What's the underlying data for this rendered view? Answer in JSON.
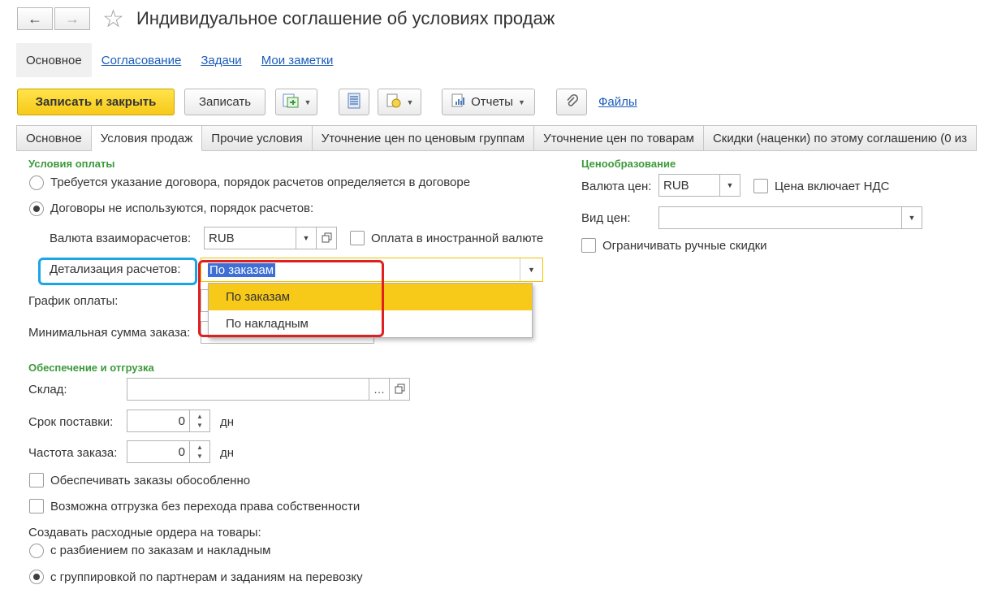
{
  "window": {
    "title": "Индивидуальное соглашение об условиях продаж",
    "back_icon": "←",
    "forward_icon": "→",
    "favorite_icon": "☆"
  },
  "nav_panel": [
    {
      "label": "Основное",
      "active": true
    },
    {
      "label": "Согласование",
      "active": false
    },
    {
      "label": "Задачи",
      "active": false
    },
    {
      "label": "Мои заметки",
      "active": false
    }
  ],
  "toolbar": {
    "save_close": "Записать и закрыть",
    "save": "Записать",
    "reports": "Отчеты",
    "files": "Файлы"
  },
  "tabs": [
    {
      "label": "Основное",
      "active": false
    },
    {
      "label": "Условия продаж",
      "active": true
    },
    {
      "label": "Прочие условия",
      "active": false
    },
    {
      "label": "Уточнение цен по ценовым группам",
      "active": false
    },
    {
      "label": "Уточнение цен по товарам",
      "active": false
    },
    {
      "label": "Скидки (наценки) по этому соглашению (0 из",
      "active": false
    }
  ],
  "payment": {
    "section_title": "Условия оплаты",
    "radio1_label": "Требуется указание договора, порядок расчетов определяется в договоре",
    "radio2_label": "Договоры не используются, порядок расчетов:",
    "currency_label": "Валюта взаиморасчетов:",
    "currency_value": "RUB",
    "foreign_currency_label": "Оплата в иностранной валюте",
    "detail_label": "Детализация расчетов:",
    "detail_value": "По заказам",
    "schedule_label": "График оплаты:",
    "min_sum_label": "Минимальная сумма заказа:",
    "dropdown_options": [
      "По заказам",
      "По накладным"
    ]
  },
  "pricing": {
    "section_title": "Ценообразование",
    "currency_label": "Валюта цен:",
    "currency_value": "RUB",
    "vat_label": "Цена включает НДС",
    "price_type_label": "Вид цен:",
    "price_type_value": "",
    "limit_discounts_label": "Ограничивать ручные скидки"
  },
  "shipping": {
    "section_title": "Обеспечение и отгрузка",
    "warehouse_label": "Склад:",
    "warehouse_value": "",
    "delivery_label": "Срок поставки:",
    "delivery_value": "0",
    "delivery_unit": "дн",
    "frequency_label": "Частота заказа:",
    "frequency_value": "0",
    "frequency_unit": "дн",
    "separate_label": "Обеспечивать заказы обособленно",
    "no_ownership_label": "Возможна отгрузка без перехода права собственности",
    "orders_label": "Создавать расходные ордера на товары:",
    "orders_radio1": "с разбиением по заказам и накладным",
    "orders_radio2": "с группировкой по партнерам и заданиям на перевозку"
  },
  "colors": {
    "accent_yellow": "#f7c919",
    "section_green": "#3c9a3a",
    "link_blue": "#1a5cb8",
    "highlight_blue": "#1aa6e6",
    "highlight_red": "#e02020"
  }
}
